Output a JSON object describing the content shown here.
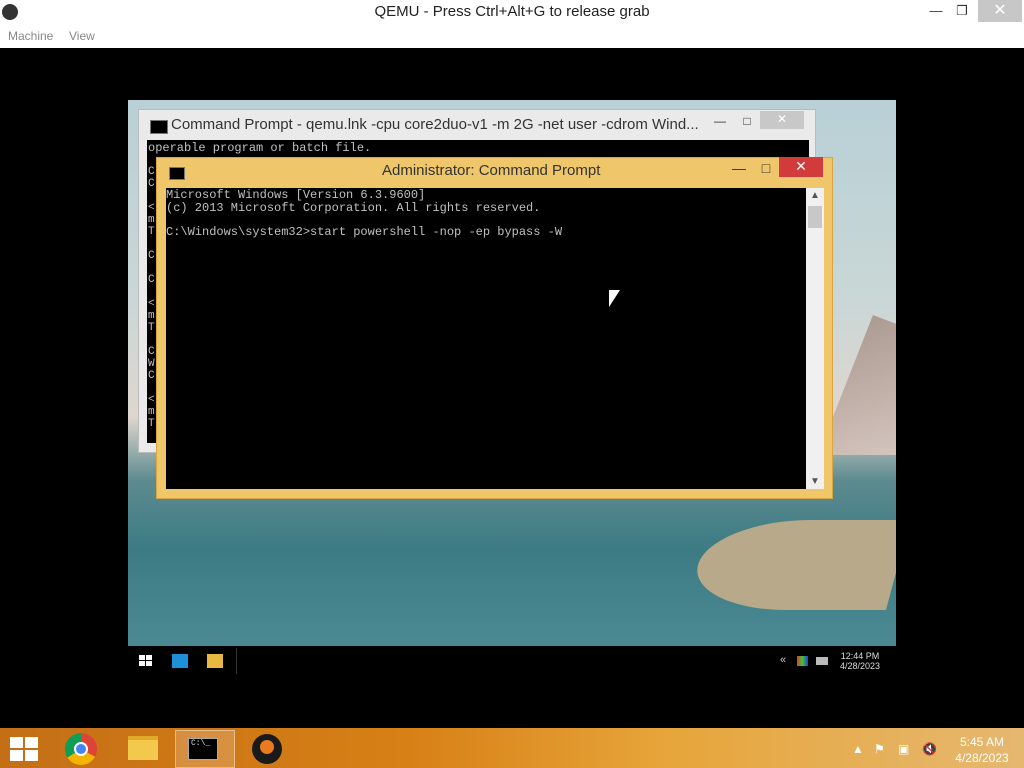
{
  "host": {
    "title": "QEMU - Press Ctrl+Alt+G to release grab",
    "menu": [
      "Machine",
      "View"
    ],
    "minimize_glyph": "—",
    "restore_glyph": "❐",
    "close_glyph": "✕",
    "clock": {
      "time": "5:45 AM",
      "date": "4/28/2023"
    },
    "taskbar_items": [
      "start-icon",
      "chrome-icon",
      "file-explorer-icon",
      "command-prompt-icon",
      "qemu-icon"
    ]
  },
  "guest": {
    "bg_cmd": {
      "title": "Command Prompt - qemu.lnk  -cpu core2duo-v1 -m 2G -net user -cdrom Wind...",
      "first_line": "operable program or batch file.",
      "left_chars": [
        "C",
        "C",
        "<",
        "m",
        "T",
        "C",
        "C",
        "<",
        "m",
        "T",
        "C",
        "W",
        "C",
        "<",
        "m",
        "T"
      ]
    },
    "fg_cmd": {
      "title": "Administrator:  Command Prompt",
      "lines": [
        "Microsoft Windows [Version 6.3.9600]",
        "(c) 2013 Microsoft Corporation. All rights reserved.",
        "",
        "C:\\Windows\\system32>start powershell -nop -ep bypass -W"
      ]
    },
    "clock": {
      "time": "12:44 PM",
      "date": "4/28/2023"
    }
  }
}
